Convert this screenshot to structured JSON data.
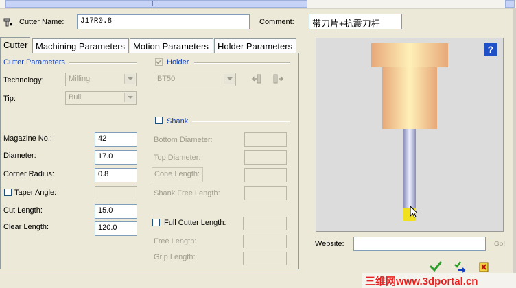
{
  "header": {
    "cutter_name_label": "Cutter Name:",
    "cutter_name_value": "J17R0.8",
    "comment_label": "Comment:",
    "comment_value": "带刀片+抗震刀杆"
  },
  "tabs": [
    {
      "label": "Cutter",
      "active": true
    },
    {
      "label": "Machining Parameters",
      "active": false
    },
    {
      "label": "Motion Parameters",
      "active": false
    },
    {
      "label": "Holder Parameters",
      "active": false
    }
  ],
  "cutter_params": {
    "section_label": "Cutter Parameters",
    "technology_label": "Technology:",
    "technology_value": "Milling",
    "tip_label": "Tip:",
    "tip_value": "Bull"
  },
  "holder": {
    "checkbox_label": "Holder",
    "checked": true,
    "value": "BT50"
  },
  "shank": {
    "checkbox_label": "Shank",
    "checked": false,
    "bottom_diameter_label": "Bottom Diameter:",
    "top_diameter_label": "Top Diameter:",
    "cone_length_label": "Cone Length:",
    "shank_free_length_label": "Shank Free Length:"
  },
  "dimensions": {
    "magazine_label": "Magazine No.:",
    "magazine_value": "42",
    "diameter_label": "Diameter:",
    "diameter_value": "17.0",
    "corner_radius_label": "Corner Radius:",
    "corner_radius_value": "0.8",
    "taper_angle_label": "Taper Angle:",
    "cut_length_label": "Cut Length:",
    "cut_length_value": "15.0",
    "clear_length_label": "Clear Length:",
    "clear_length_value": "120.0"
  },
  "full_cutter": {
    "checkbox_label": "Full Cutter Length:",
    "free_length_label": "Free Length:",
    "grip_length_label": "Grip Length:"
  },
  "preview": {
    "help_label": "?"
  },
  "website": {
    "label": "Website:",
    "value": "",
    "go_label": "Go!"
  },
  "watermark": "三维网www.3dportal.cn",
  "colors": {
    "holder_fill": "#f0c090",
    "shank_fill": "#b8bcd8",
    "tip_fill": "#f0e020",
    "ok_green": "#2a9d2a"
  }
}
